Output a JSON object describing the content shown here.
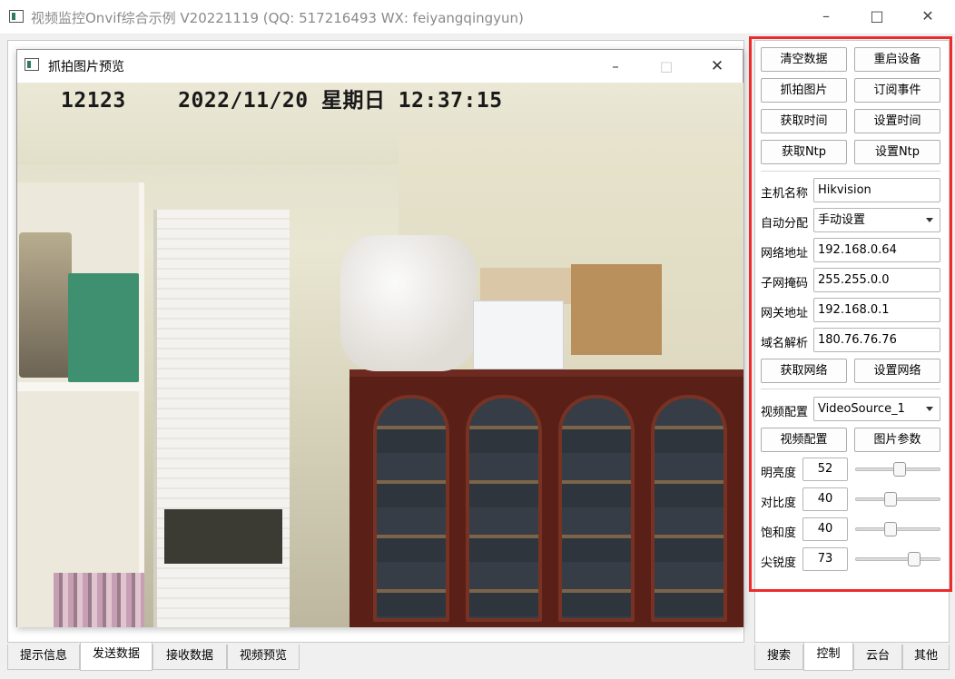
{
  "window": {
    "title": "视频监控Onvif综合示例 V20221119 (QQ: 517216493 WX: feiyangqingyun)",
    "minimize_icon": "minimize-icon",
    "maximize_icon": "maximize-icon",
    "close_icon": "close-icon"
  },
  "preview": {
    "title": "抓拍图片预览",
    "osd_text": "12123    2022/11/20 星期日 12:37:15"
  },
  "left_tabs": [
    {
      "label": "提示信息",
      "active": false
    },
    {
      "label": "发送数据",
      "active": true
    },
    {
      "label": "接收数据",
      "active": false
    },
    {
      "label": "视频预览",
      "active": false
    }
  ],
  "right_tabs": [
    {
      "label": "搜索",
      "active": false
    },
    {
      "label": "控制",
      "active": true
    },
    {
      "label": "云台",
      "active": false
    },
    {
      "label": "其他",
      "active": false
    }
  ],
  "controls": {
    "clear_data": "清空数据",
    "reboot_device": "重启设备",
    "snapshot": "抓拍图片",
    "subscribe_event": "订阅事件",
    "get_time": "获取时间",
    "set_time": "设置时间",
    "get_ntp": "获取Ntp",
    "set_ntp": "设置Ntp",
    "get_network": "获取网络",
    "set_network": "设置网络",
    "video_config_button": "视频配置",
    "image_params": "图片参数"
  },
  "network": {
    "hostname_label": "主机名称",
    "hostname": "Hikvision",
    "dhcp_label": "自动分配",
    "dhcp": "手动设置",
    "ip_label": "网络地址",
    "ip": "192.168.0.64",
    "mask_label": "子网掩码",
    "mask": "255.255.0.0",
    "gateway_label": "网关地址",
    "gateway": "192.168.0.1",
    "dns_label": "域名解析",
    "dns": "180.76.76.76"
  },
  "video": {
    "config_label": "视频配置",
    "source": "VideoSource_1"
  },
  "image": {
    "brightness_label": "明亮度",
    "brightness": 52,
    "contrast_label": "对比度",
    "contrast": 40,
    "saturation_label": "饱和度",
    "saturation": 40,
    "sharpness_label": "尖锐度",
    "sharpness": 73
  },
  "colors": {
    "highlight_border": "#ee2b2b",
    "cabinet": "#5a1f17",
    "accent_green": "#2e7d5a"
  }
}
